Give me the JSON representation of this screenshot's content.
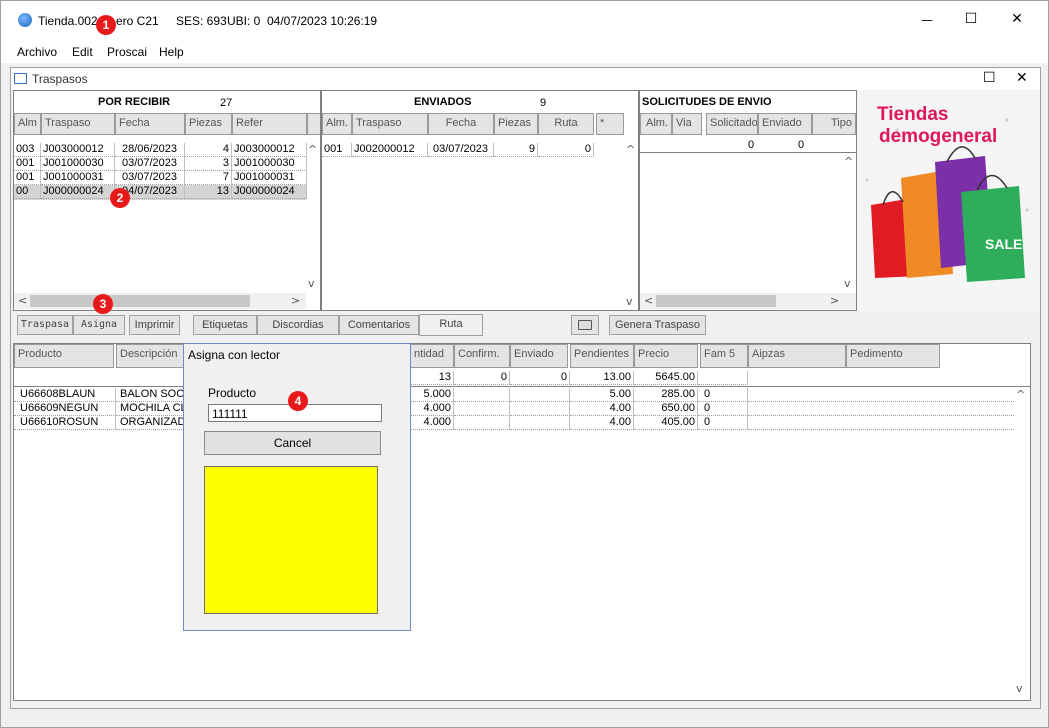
{
  "window": {
    "title": "Tienda.002",
    "title_rest": "ero C21",
    "ses": "SES: 693",
    "ubi": "UBI: 0",
    "datetime": "04/07/2023 10:26:19",
    "minimize": "—",
    "maximize": "☐",
    "close": "✕"
  },
  "menu": [
    "Archivo",
    "Edit",
    "Proscai",
    "Help"
  ],
  "child": {
    "title": "Traspasos",
    "maximize": "☐",
    "close": "✕"
  },
  "badges": [
    "1",
    "2",
    "3",
    "4"
  ],
  "por_recibir": {
    "title": "POR RECIBIR",
    "count": "27",
    "headers": [
      "Alm",
      "Traspaso",
      "Fecha",
      "Piezas",
      "Refer"
    ],
    "rows": [
      [
        "003",
        "J003000012",
        "28/06/2023",
        "4",
        "J003000012"
      ],
      [
        "001",
        "J001000030",
        "03/07/2023",
        "3",
        "J001000030"
      ],
      [
        "001",
        "J001000031",
        "03/07/2023",
        "7",
        "J001000031"
      ],
      [
        "00",
        "J000000024",
        "04/07/2023",
        "13",
        "J000000024"
      ]
    ]
  },
  "enviados": {
    "title": "ENVIADOS",
    "count": "9",
    "headers": [
      "Alm.",
      "Traspaso",
      "Fecha",
      "Piezas",
      "Ruta",
      "*"
    ],
    "rows": [
      [
        "001",
        "J002000012",
        "03/07/2023",
        "9",
        "0"
      ]
    ]
  },
  "solicitudes": {
    "title": "SOLICITUDES DE ENVIO",
    "headers": [
      "Alm.",
      "Via",
      "Solicitado",
      "Enviado",
      "Tipo"
    ],
    "totals": [
      "0",
      "0"
    ]
  },
  "promo": {
    "line1": "Tiendas",
    "line2": "demogeneral",
    "sale": "SALE"
  },
  "tabs": [
    "Traspasa",
    "Asigna",
    "Imprimir",
    "Etiquetas",
    "Discordias",
    "Comentarios",
    "Ruta"
  ],
  "genera_button": "Genera Traspaso",
  "detail": {
    "headers": [
      "Producto",
      "Descripción",
      "ntidad",
      "Confirm.",
      "Enviado",
      "Pendientes",
      "Precio",
      "Fam 5",
      "Aipzas",
      "Pedimento"
    ],
    "totals": {
      "cantidad": "13",
      "confirm": "0",
      "enviado": "0",
      "pendientes": "13.00",
      "precio": "5645.00"
    },
    "rows": [
      {
        "producto": "U66608BLAUN",
        "descripcion": "BALON SOCC",
        "cantidad": "5.000",
        "pendientes": "5.00",
        "precio": "285.00",
        "fam": "0"
      },
      {
        "producto": "U66609NEGUN",
        "descripcion": "MOCHILA CL",
        "cantidad": "4.000",
        "pendientes": "4.00",
        "precio": "650.00",
        "fam": "0"
      },
      {
        "producto": "U66610ROSUN",
        "descripcion": "ORGANIZAD",
        "cantidad": "4.000",
        "pendientes": "4.00",
        "precio": "405.00",
        "fam": "0"
      }
    ]
  },
  "dialog": {
    "title": "Asigna con lector",
    "label": "Producto",
    "value": "111111",
    "cancel": "Cancel",
    "swatch_color": "#ffff00"
  }
}
